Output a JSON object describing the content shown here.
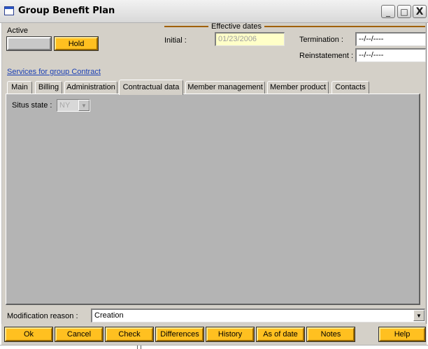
{
  "window": {
    "title": "Group Benefit Plan",
    "controls": {
      "minimize": "_",
      "maximize": "□",
      "close": "X"
    }
  },
  "status": {
    "active_label": "Active",
    "active_button_label": "",
    "hold_button_label": "Hold"
  },
  "effective_dates": {
    "group_title": "Effective dates",
    "initial_label": "Initial :",
    "initial_value": "01/23/2006",
    "termination_label": "Termination :",
    "termination_value": "--/--/----",
    "reinstatement_label": "Reinstatement :",
    "reinstatement_value": "--/--/----"
  },
  "services_link": "Services for group Contract",
  "tabs": [
    {
      "label": "Main",
      "active": false
    },
    {
      "label": "Billing",
      "active": false
    },
    {
      "label": "Administration",
      "active": false
    },
    {
      "label": "Contractual data",
      "active": true
    },
    {
      "label": "Member management",
      "active": false
    },
    {
      "label": "Member product",
      "active": false
    },
    {
      "label": "Contacts",
      "active": false
    }
  ],
  "contractual": {
    "situs_state_label": "Situs state :",
    "situs_state_value": "NY"
  },
  "modification": {
    "label": "Modification reason :",
    "value": "Creation"
  },
  "actions": {
    "ok": "Ok",
    "cancel": "Cancel",
    "check": "Check",
    "differences": "Differences",
    "history": "History",
    "as_of_date": "As of date",
    "notes": "Notes",
    "help": "Help"
  },
  "icons": {
    "app": "window-icon",
    "dropdown": "chevron-down-icon"
  },
  "colors": {
    "accent_button": "#ffc020",
    "panel_background": "#d4d0c8",
    "tab_content_background": "#b4b4b4",
    "link": "#1a3fb4",
    "group_rule": "#a06000"
  }
}
